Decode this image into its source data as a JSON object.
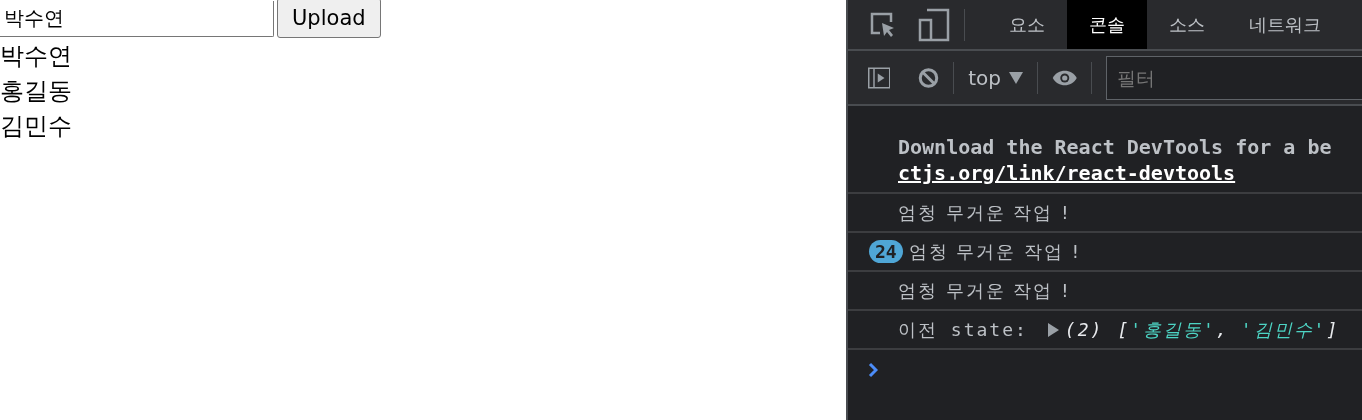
{
  "page": {
    "name_field": {
      "value": "박수연"
    },
    "upload_button": "Upload",
    "names": [
      "박수연",
      "홍길동",
      "김민수"
    ]
  },
  "devtools": {
    "tabs": [
      {
        "label": "요소",
        "selected": false
      },
      {
        "label": "콘솔",
        "selected": true
      },
      {
        "label": "소스",
        "selected": false
      },
      {
        "label": "네트워크",
        "selected": false
      }
    ],
    "toolbar": {
      "context": "top",
      "filter": {
        "placeholder": "필터"
      }
    },
    "messages": [
      {
        "kind": "link",
        "text": "Download the React DevTools for a be",
        "link": "ctjs.org/link/react-devtools"
      },
      {
        "kind": "log",
        "text": "엄청 무거운 작업 !"
      },
      {
        "kind": "log",
        "count": "24",
        "text": "엄청 무거운 작업 !"
      },
      {
        "kind": "log",
        "text": "엄청 무거운 작업 !"
      },
      {
        "kind": "state",
        "text": "이전 state:",
        "summary": "(2)",
        "open": "[",
        "items": [
          "'홍길동'",
          "'김민수'"
        ],
        "separator": ",",
        "close": "]"
      }
    ]
  }
}
